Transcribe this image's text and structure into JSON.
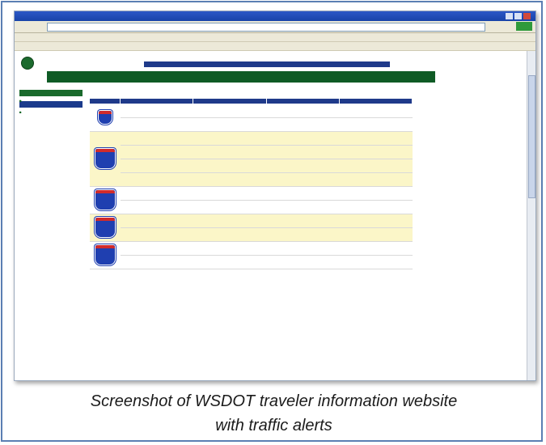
{
  "caption": {
    "line1": "Screenshot of WSDOT traveler information website",
    "line2": "with traffic alerts"
  }
}
